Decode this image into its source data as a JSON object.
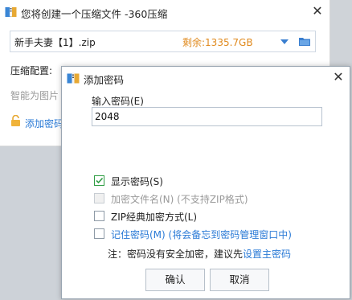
{
  "bg_window": {
    "title": "您将创建一个压缩文件 -360压缩",
    "close_glyph": "✕",
    "path_value": "新手夫妻【1】.zip",
    "free_space": "剩余:1335.7GB",
    "config_label": "压缩配置:",
    "smart_text": "智能为图片",
    "add_password_link": "添加密码"
  },
  "dialog": {
    "title": "添加密码",
    "close_glyph": "✕",
    "password_label": "输入密码(E)",
    "password_value": "2048",
    "options": {
      "show_password": {
        "label": "显示密码(S)",
        "checked": true
      },
      "encrypt_filenames": {
        "label": "加密文件名(N) (不支持ZIP格式)",
        "checked": false,
        "disabled": true
      },
      "zip_classic": {
        "label": "ZIP经典加密方式(L)",
        "checked": false
      },
      "remember_password": {
        "label": "记住密码(M) (将会备忘到密码管理窗口中)",
        "checked": false
      }
    },
    "note_prefix": "注：密码没有安全加密，建议先",
    "note_link": "设置主密码",
    "ok_label": "确认",
    "cancel_label": "取消"
  },
  "colors": {
    "accent_blue": "#2a7ad6",
    "free_space_orange": "#e08a1e",
    "check_green": "#2f9d44"
  }
}
